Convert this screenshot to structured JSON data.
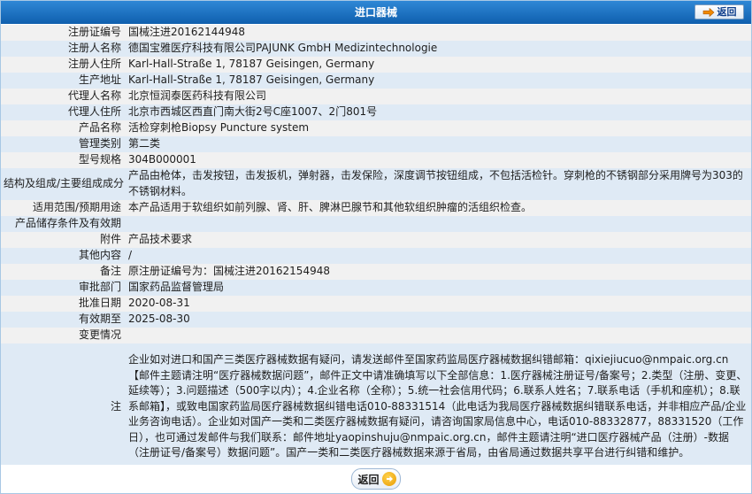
{
  "header": {
    "title": "进口器械",
    "back_label": "返回"
  },
  "rows": [
    {
      "label": "注册证编号",
      "value": "国械注进20162144948"
    },
    {
      "label": "注册人名称",
      "value": "德国宝雅医疗科技有限公司PAJUNK GmbH Medizintechnologie"
    },
    {
      "label": "注册人住所",
      "value": "Karl-Hall-Straße 1, 78187 Geisingen, Germany"
    },
    {
      "label": "生产地址",
      "value": "Karl-Hall-Straße 1, 78187 Geisingen, Germany"
    },
    {
      "label": "代理人名称",
      "value": "北京恒润泰医药科技有限公司"
    },
    {
      "label": "代理人住所",
      "value": "北京市西城区西直门南大街2号C座1007、2门801号"
    },
    {
      "label": "产品名称",
      "value": "活检穿刺枪Biopsy Puncture system"
    },
    {
      "label": "管理类别",
      "value": "第二类"
    },
    {
      "label": "型号规格",
      "value": "304B000001"
    },
    {
      "label": "结构及组成/主要组成成分",
      "value": "产品由枪体，击发按钮，击发扳机，弹射器，击发保险，深度调节按钮组成，不包括活检针。穿刺枪的不锈钢部分采用牌号为303的不锈钢材料。"
    },
    {
      "label": "适用范围/预期用途",
      "value": "本产品适用于软组织如前列腺、肾、肝、脾淋巴腺节和其他软组织肿瘤的活组织检查。"
    },
    {
      "label": "产品储存条件及有效期",
      "value": ""
    },
    {
      "label": "附件",
      "value": "产品技术要求"
    },
    {
      "label": "其他内容",
      "value": "/"
    },
    {
      "label": "备注",
      "value": "原注册证编号为：国械注进20162154948"
    },
    {
      "label": "审批部门",
      "value": "国家药品监督管理局"
    },
    {
      "label": "批准日期",
      "value": "2020-08-31"
    },
    {
      "label": "有效期至",
      "value": "2025-08-30"
    },
    {
      "label": "变更情况",
      "value": ""
    },
    {
      "label": "注",
      "value": "企业如对进口和国产三类医疗器械数据有疑问，请发送邮件至国家药监局医疗器械数据纠错邮箱：qixiejiucuo@nmpaic.org.cn【邮件主题请注明“医疗器械数据问题”，邮件正文中请准确填写以下全部信息：1.医疗器械注册证号/备案号；2.类型（注册、变更、延续等）；3.问题描述（500字以内）；4.企业名称（全称）；5.统一社会信用代码；6.联系人姓名；7.联系电话（手机和座机）；8.联系邮箱】，或致电国家药监局医疗器械数据纠错电话010-88331514（此电话为我局医疗器械数据纠错联系电话，并非相应产品/企业业务咨询电话）。企业如对国产一类和二类医疗器械数据有疑问，请咨询国家局信息中心，电话010-88332877，88331520（工作日），也可通过发邮件与我们联系：邮件地址yaopinshuju@nmpaic.org.cn，邮件主题请注明“进口医疗器械产品（注册）-数据（注册证号/备案号）数据问题”。国产一类和二类医疗器械数据来源于省局，由省局通过数据共享平台进行纠错和维护。"
    }
  ],
  "footer": {
    "back_label": "返回"
  }
}
